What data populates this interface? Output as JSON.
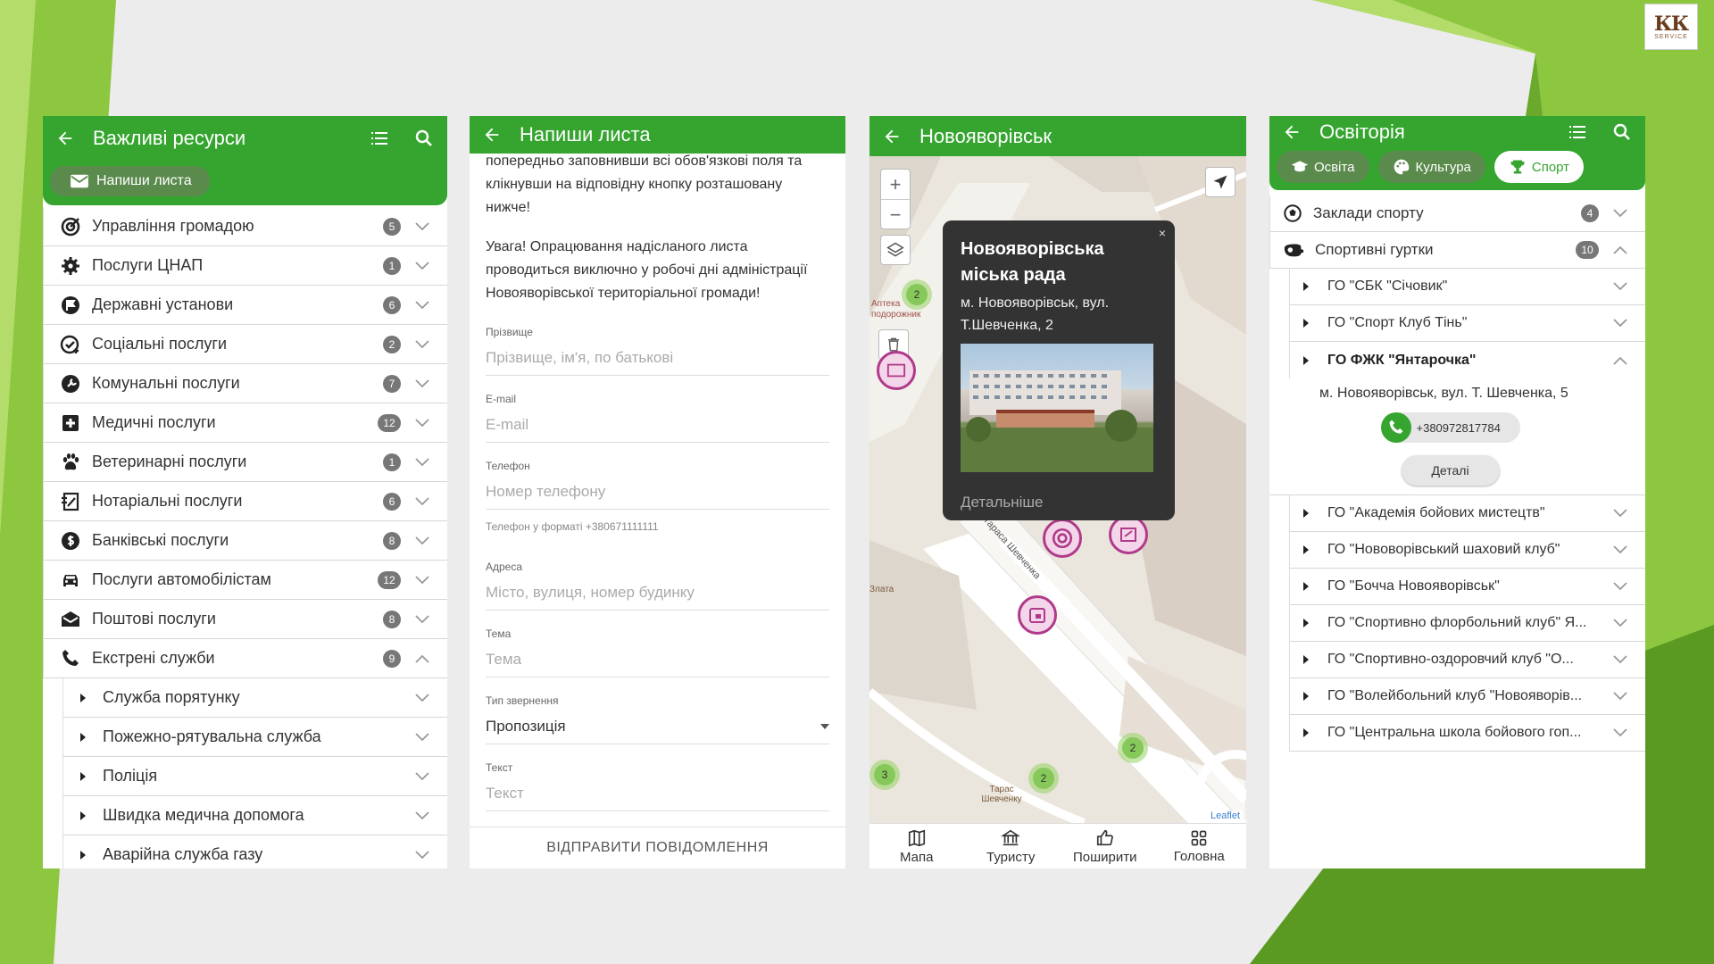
{
  "colors": {
    "primary": "#35a530",
    "chip": "#5b8a4d",
    "badge": "#777777",
    "pin": "#b03a8a",
    "background_green": "#8dc63f"
  },
  "logo": {
    "mark": "КК",
    "sub": "SERVICE"
  },
  "panel1": {
    "title": "Важливі ресурси",
    "write_chip": "Напиши листа",
    "items": [
      {
        "label": "Управління громадою",
        "count": "5",
        "icon": "target-icon"
      },
      {
        "label": "Послуги ЦНАП",
        "count": "1",
        "icon": "gear-icon"
      },
      {
        "label": "Державні установи",
        "count": "6",
        "icon": "flag-icon"
      },
      {
        "label": "Соціальні послуги",
        "count": "2",
        "icon": "social-icon"
      },
      {
        "label": "Комунальні послуги",
        "count": "7",
        "icon": "wrench-icon"
      },
      {
        "label": "Медичні послуги",
        "count": "12",
        "icon": "medical-icon"
      },
      {
        "label": "Ветеринарні послуги",
        "count": "1",
        "icon": "paw-icon"
      },
      {
        "label": "Нотаріальні послуги",
        "count": "6",
        "icon": "notary-icon"
      },
      {
        "label": "Банківські послуги",
        "count": "8",
        "icon": "dollar-icon"
      },
      {
        "label": "Послуги автомобілістам",
        "count": "12",
        "icon": "car-icon"
      },
      {
        "label": "Поштові послуги",
        "count": "8",
        "icon": "mail-icon"
      },
      {
        "label": "Екстрені служби",
        "count": "9",
        "icon": "phone-icon"
      }
    ],
    "subitems": [
      "Служба порятунку",
      "Пожежно-рятувальна служба",
      "Поліція",
      "Швидка медична допомога",
      "Аварійна служба газу"
    ]
  },
  "panel2": {
    "title": "Напиши листа",
    "intro": "попередньо заповнивши всі обов'язкові поля та клікнувши на відповідну кнопку розташовану нижче!",
    "warning": "Увага! Опрацювання надісланого листа проводиться виключно у робочі дні адміністрації Новояворівської територіальної громади!",
    "fields": [
      {
        "label": "Прізвище",
        "placeholder": "Прізвище, ім'я, по батькові"
      },
      {
        "label": "E-mail",
        "placeholder": "E-mail"
      },
      {
        "label": "Телефон",
        "placeholder": "Номер телефону",
        "hint": "Телефон у форматі +380671111111"
      },
      {
        "label": "Адреса",
        "placeholder": "Місто, вулиця, номер будинку"
      },
      {
        "label": "Тема",
        "placeholder": "Тема"
      },
      {
        "label": "Тип звернення",
        "value": "Пропозиція"
      },
      {
        "label": "Текст",
        "placeholder": "Текст"
      }
    ],
    "send": "ВІДПРАВИТИ ПОВІДОМЛЕННЯ"
  },
  "panel3": {
    "title": "Новояворівськ",
    "popup": {
      "name": "Новояворівська міська рада",
      "address": "м. Новояворівськ, вул. Т.Шевченка, 2",
      "more": "Детальніше",
      "close": "×"
    },
    "clusters": [
      "2",
      "2",
      "3",
      "2"
    ],
    "labels": {
      "pharmacy": "Аптека подорожник",
      "street": "вул. Тараса Шевченка",
      "zlata": "Злата",
      "taras": "Тарас Шевченку"
    },
    "attribution": "Leaflet",
    "nav": [
      {
        "label": "Мапа",
        "icon": "map-icon"
      },
      {
        "label": "Туристу",
        "icon": "museum-icon"
      },
      {
        "label": "Поширити",
        "icon": "thumbs-up-icon"
      },
      {
        "label": "Головна",
        "icon": "grid-icon"
      }
    ]
  },
  "panel4": {
    "title": "Освіторія",
    "chips": [
      {
        "label": "Освіта",
        "icon": "graduation-cap-icon",
        "active": false
      },
      {
        "label": "Культура",
        "icon": "palette-icon",
        "active": false
      },
      {
        "label": "Спорт",
        "icon": "trophy-icon",
        "active": true
      }
    ],
    "categories": [
      {
        "label": "Заклади спорту",
        "count": "4"
      },
      {
        "label": "Спортивні гуртки",
        "count": "10"
      }
    ],
    "clubs_top": [
      "ГО \"СБК \"Січовик\"",
      "ГО \"Спорт Клуб Тінь\""
    ],
    "club_open": "ГО ФЖК \"Янтарочка\"",
    "club_address": "м. Новояворівськ, вул. Т. Шевченка, 5",
    "club_phone": "+380972817784",
    "details": "Деталі",
    "clubs_bottom": [
      "ГО \"Академія бойових мистецтв\"",
      "ГО \"Нововорівський шаховий клуб\"",
      "ГО \"Бочча Новояворівськ\"",
      "ГО \"Спортивно флорбольний клуб\" Я...",
      "ГО \"Спортивно-оздоровчий клуб \"О...",
      "ГО \"Волейбольний клуб \"Новояворів...",
      "ГО \"Центральна школа бойового гоп..."
    ]
  }
}
